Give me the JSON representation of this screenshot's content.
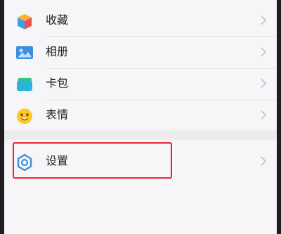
{
  "menu": {
    "items": [
      {
        "label": "收藏",
        "icon": "favorites-cube-icon"
      },
      {
        "label": "相册",
        "icon": "album-image-icon"
      },
      {
        "label": "卡包",
        "icon": "card-wallet-icon"
      },
      {
        "label": "表情",
        "icon": "smiley-face-icon"
      }
    ],
    "settings": {
      "label": "设置",
      "icon": "settings-gear-icon"
    }
  },
  "colors": {
    "highlight": "#e8232d",
    "settings_icon": "#3f8fd8"
  }
}
